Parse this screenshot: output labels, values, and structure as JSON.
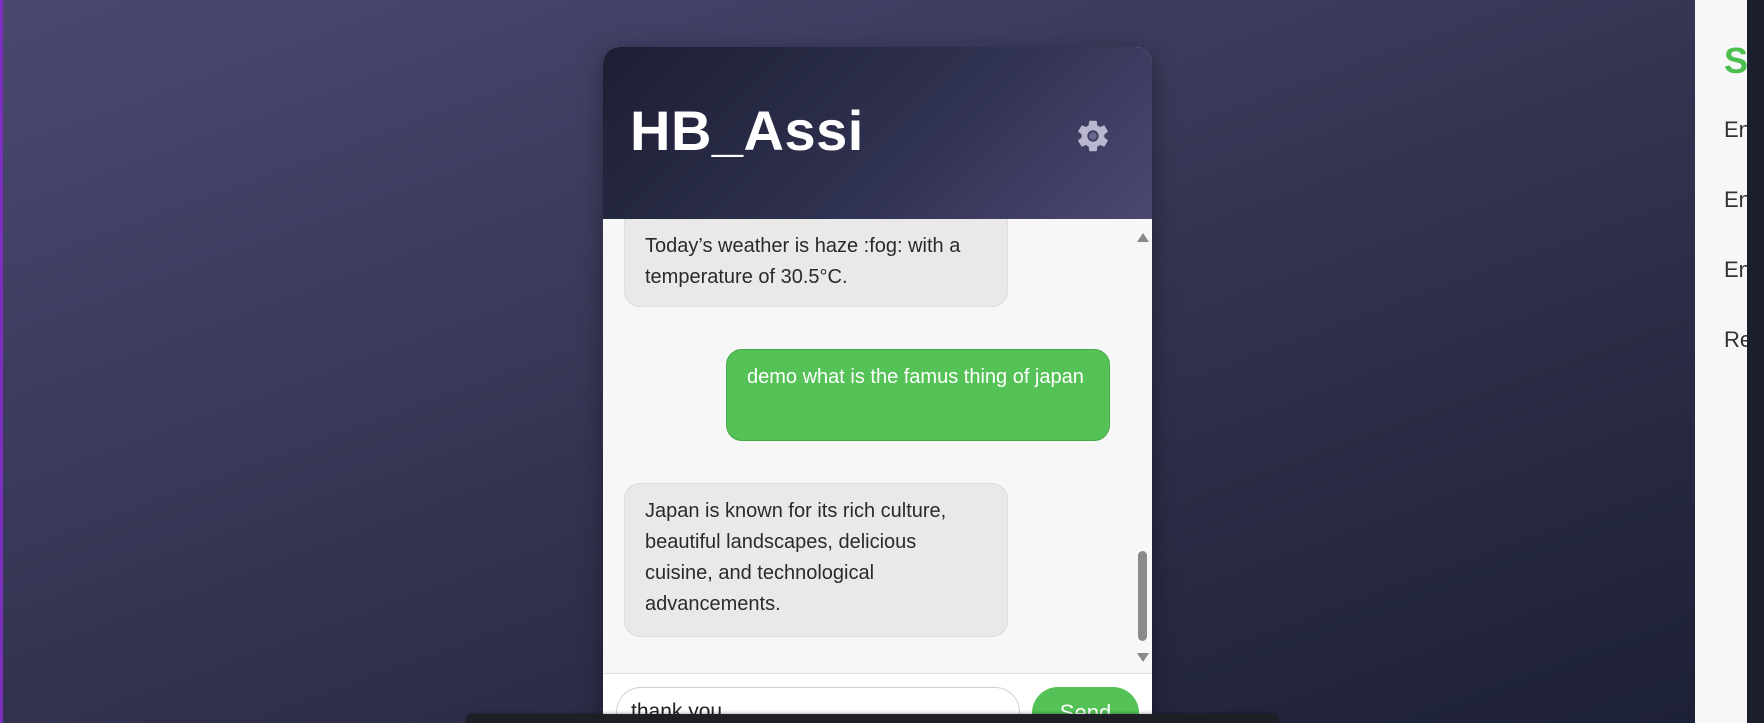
{
  "chat": {
    "title": "HB_Assi",
    "settings_icon": "gear-icon",
    "messages": [
      {
        "role": "bot",
        "text": "Today’s weather is haze :fog: with a temperature of 30.5°C."
      },
      {
        "role": "user",
        "text": "demo what is the famus thing of japan"
      },
      {
        "role": "bot",
        "text": "Japan is known for its rich culture, beautiful landscapes, delicious cuisine, and technological advancements."
      }
    ],
    "input_value": "thank you",
    "send_label": "Send"
  },
  "side_panel": {
    "title": "Se",
    "items": [
      "En",
      "En",
      "En",
      "Re"
    ]
  },
  "colors": {
    "accent_green": "#54c256",
    "header_dark": "#1c1f33",
    "header_purple": "#4b4872"
  }
}
